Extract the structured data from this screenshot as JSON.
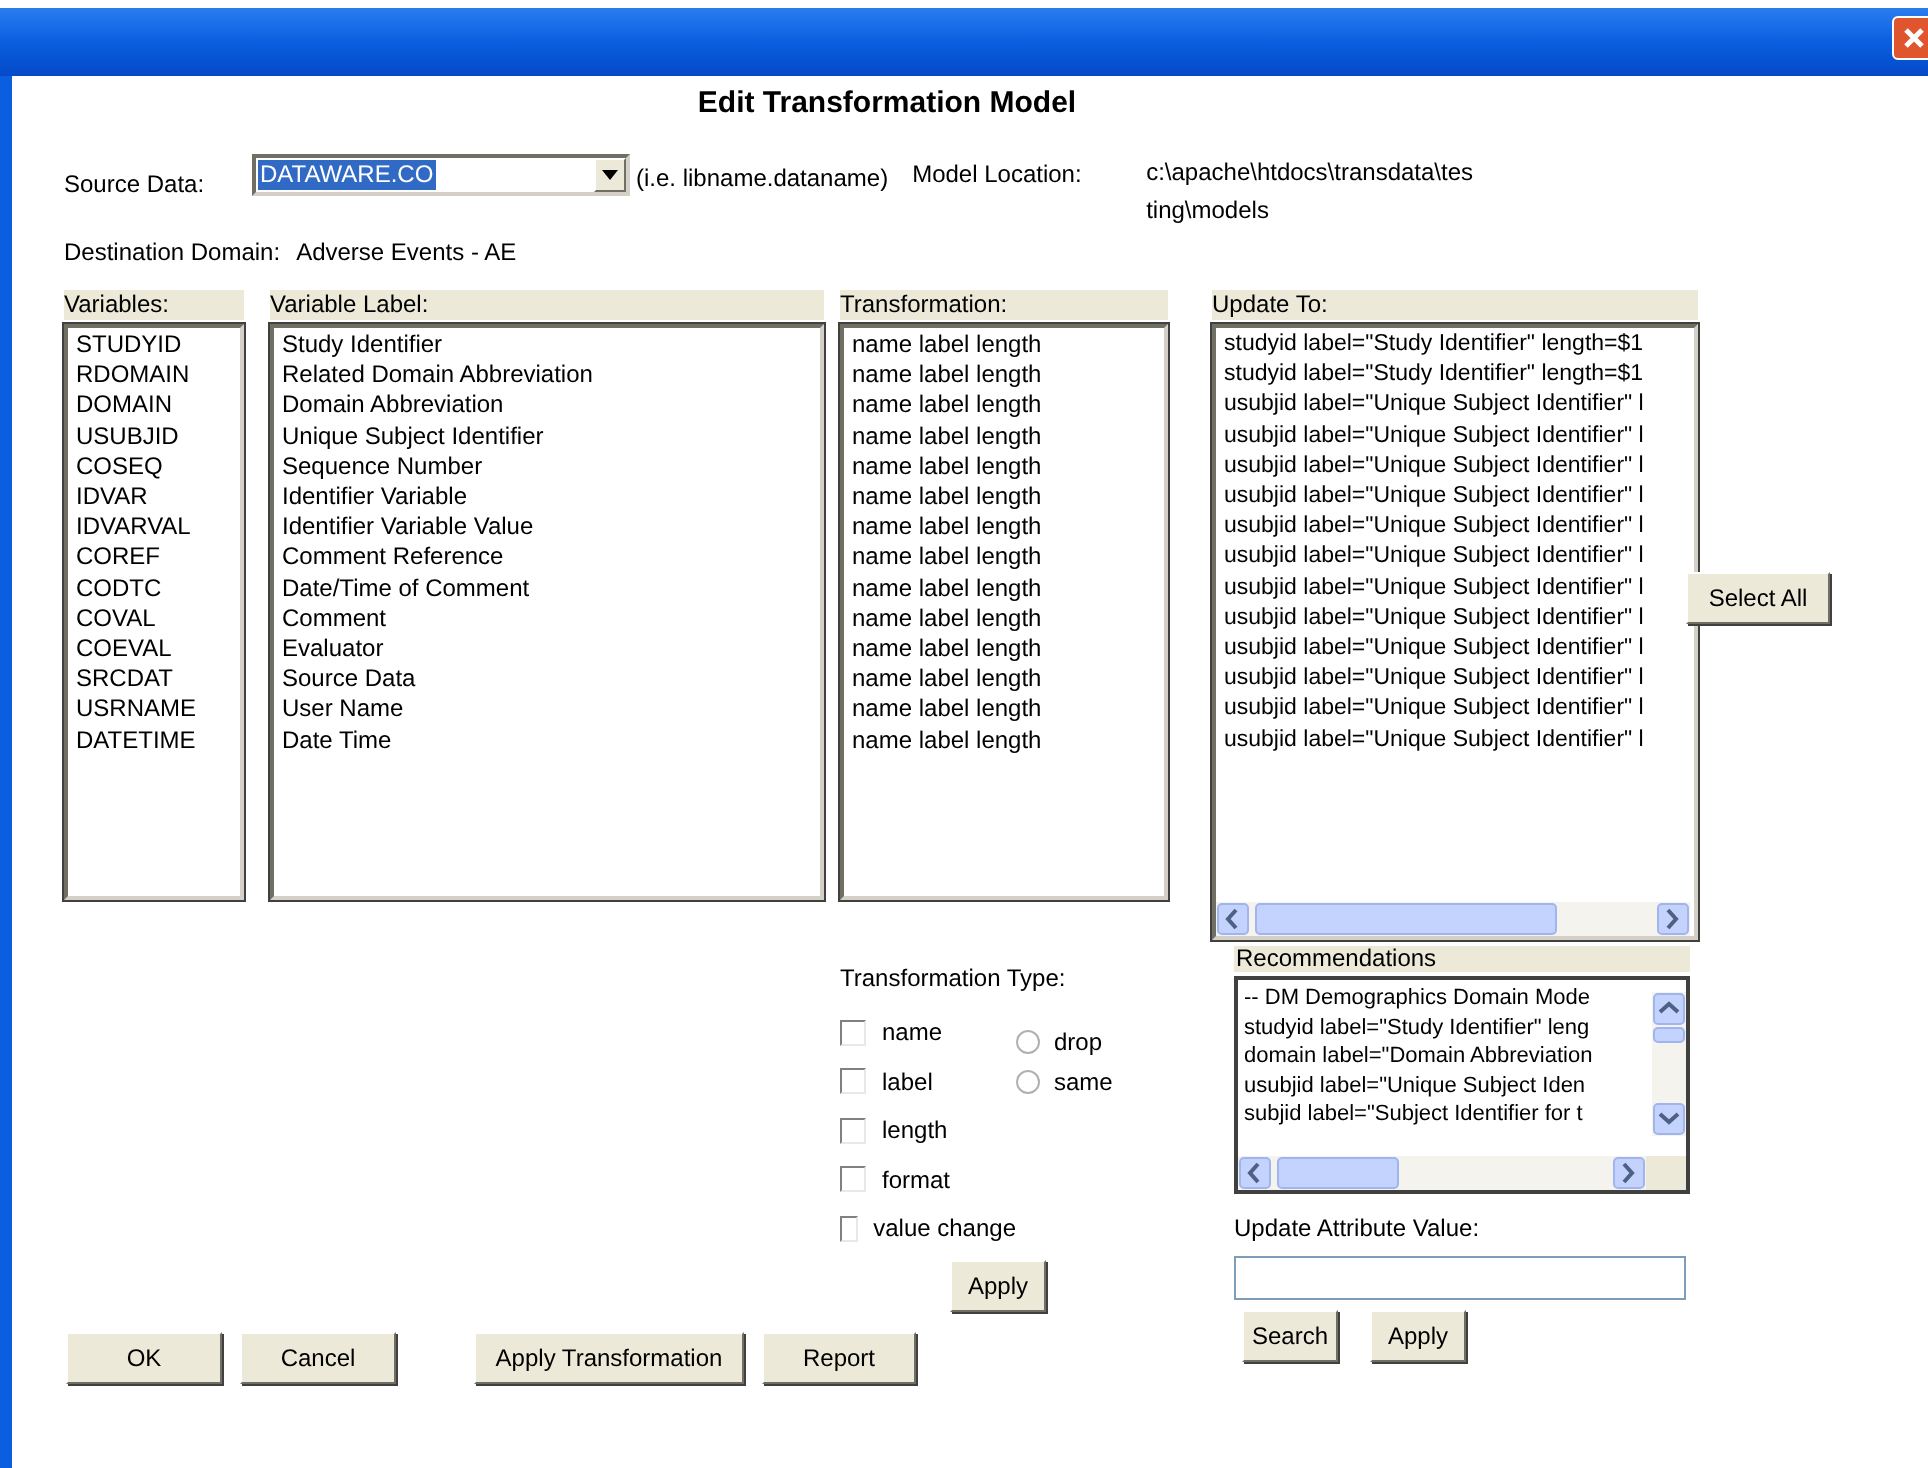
{
  "title": "Edit Transformation Model",
  "source_data": {
    "label": "Source Data:",
    "value": "DATAWARE.CO",
    "highlighted": true,
    "hint": "(i.e. libname.dataname)"
  },
  "model_location": {
    "label": "Model Location:",
    "lines": [
      "c:\\apache\\htdocs\\transdata\\tes",
      "ting\\models"
    ]
  },
  "destination_domain": {
    "label": "Destination Domain:",
    "value": "Adverse Events - AE"
  },
  "variables": {
    "header": "Variables:",
    "items": [
      "STUDYID",
      "RDOMAIN",
      "DOMAIN",
      "USUBJID",
      "COSEQ",
      "IDVAR",
      "IDVARVAL",
      "COREF",
      "CODTC",
      "COVAL",
      "COEVAL",
      "SRCDAT",
      "USRNAME",
      "DATETIME"
    ]
  },
  "variable_label": {
    "header": "Variable Label:",
    "items": [
      "Study Identifier",
      "Related Domain Abbreviation",
      "Domain Abbreviation",
      "Unique Subject Identifier",
      "Sequence Number",
      "Identifier Variable",
      "Identifier Variable Value",
      "Comment Reference",
      "Date/Time of Comment",
      "Comment",
      "Evaluator",
      "Source Data",
      "User Name",
      "Date Time"
    ]
  },
  "transformation": {
    "header": "Transformation:",
    "items": [
      "name label length",
      "name label length",
      "name label length",
      "name label length",
      "name label length",
      "name label length",
      "name label length",
      "name label length",
      "name label length",
      "name label length",
      "name label length",
      "name label length",
      "name label length",
      "name label length"
    ]
  },
  "update_to": {
    "header": "Update To:",
    "items": [
      "studyid label=\"Study Identifier\" length=$1",
      "studyid label=\"Study Identifier\" length=$1",
      "usubjid label=\"Unique Subject Identifier\" l",
      "usubjid label=\"Unique Subject Identifier\" l",
      "usubjid label=\"Unique Subject Identifier\" l",
      "usubjid label=\"Unique Subject Identifier\" l",
      "usubjid label=\"Unique Subject Identifier\" l",
      "usubjid label=\"Unique Subject Identifier\" l",
      "usubjid label=\"Unique Subject Identifier\" l",
      "usubjid label=\"Unique Subject Identifier\" l",
      "usubjid label=\"Unique Subject Identifier\" l",
      "usubjid label=\"Unique Subject Identifier\" l",
      "usubjid label=\"Unique Subject Identifier\" l",
      "usubjid label=\"Unique Subject Identifier\" l"
    ]
  },
  "select_all_button": "Select All",
  "transformation_type": {
    "label": "Transformation Type:",
    "checkboxes": [
      {
        "label": "name",
        "checked": false
      },
      {
        "label": "label",
        "checked": false
      },
      {
        "label": "length",
        "checked": false
      },
      {
        "label": "format",
        "checked": false
      },
      {
        "label": "value change",
        "checked": false
      }
    ],
    "radios": [
      {
        "label": "drop",
        "selected": false
      },
      {
        "label": "same",
        "selected": false
      }
    ],
    "apply_button": "Apply"
  },
  "recommendations": {
    "header": "Recommendations",
    "items": [
      "-- DM  Demographics Domain Mode",
      "studyid label=\"Study Identifier\" leng",
      "domain label=\"Domain Abbreviation",
      "usubjid label=\"Unique Subject Iden",
      "subjid label=\"Subject Identifier for t"
    ]
  },
  "update_attribute": {
    "label": "Update Attribute Value:",
    "buttons": [
      "Search",
      "Apply"
    ]
  },
  "bottom_buttons": [
    "OK",
    "Cancel",
    "Apply Transformation",
    "Report"
  ]
}
